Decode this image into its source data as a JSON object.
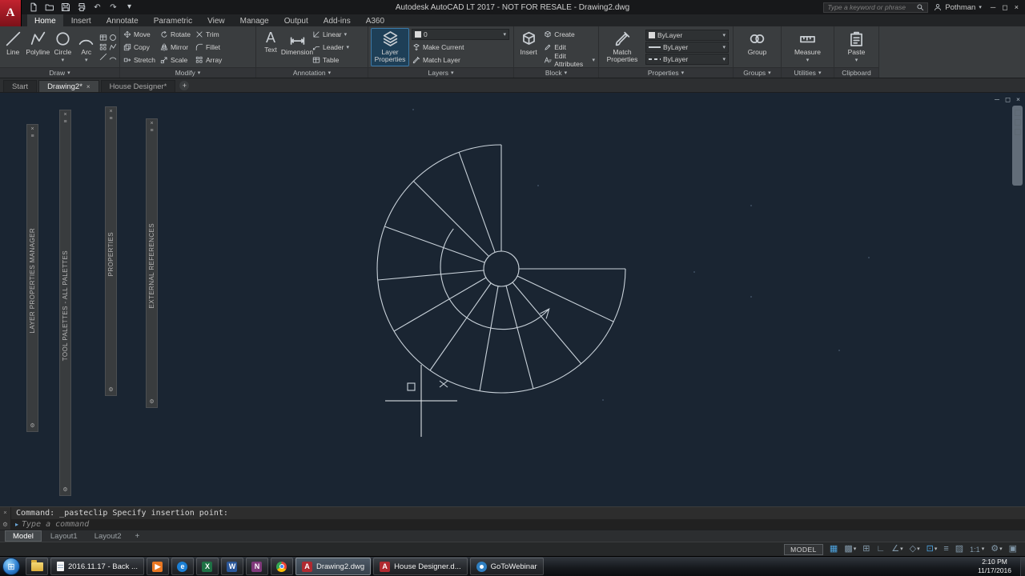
{
  "icons": {
    "caret": "▾",
    "close": "×",
    "minimize": "─",
    "maximize": "◻",
    "undo": "↶",
    "redo": "↷",
    "plus": "+",
    "app_logo": "A",
    "text_tool": "A",
    "menu": "≡",
    "gear": "⚙",
    "prompt_arrow": "▸",
    "grid": "▦",
    "snap": "▩",
    "infer": "⊞",
    "ortho": "∟",
    "polar": "∠",
    "iso": "◇",
    "osnap": "⊡",
    "lineweight": "≡",
    "transparency": "▨",
    "clean_screen": "▣",
    "start": "⊞",
    "play": "▶",
    "excel": "X",
    "word": "W",
    "onenote": "N",
    "ie": "e"
  },
  "titlebar": {
    "title": "Autodesk AutoCAD LT 2017 - NOT FOR RESALE - Drawing2.dwg",
    "search_placeholder": "Type a keyword or phrase",
    "user": "Pothman"
  },
  "ribbon": {
    "tabs": [
      {
        "label": "Home",
        "active": true
      },
      {
        "label": "Insert",
        "active": false
      },
      {
        "label": "Annotate",
        "active": false
      },
      {
        "label": "Parametric",
        "active": false
      },
      {
        "label": "View",
        "active": false
      },
      {
        "label": "Manage",
        "active": false
      },
      {
        "label": "Output",
        "active": false
      },
      {
        "label": "Add-ins",
        "active": false
      },
      {
        "label": "A360",
        "active": false
      }
    ],
    "panels": {
      "draw": {
        "label": "Draw",
        "line": "Line",
        "polyline": "Polyline",
        "circle": "Circle",
        "arc": "Arc"
      },
      "modify": {
        "label": "Modify",
        "move": "Move",
        "rotate": "Rotate",
        "trim": "Trim",
        "copy": "Copy",
        "mirror": "Mirror",
        "fillet": "Fillet",
        "stretch": "Stretch",
        "scale": "Scale",
        "array": "Array"
      },
      "annotation": {
        "label": "Annotation",
        "text": "Text",
        "dimension": "Dimension",
        "linear": "Linear",
        "leader": "Leader",
        "table": "Table"
      },
      "layers": {
        "label": "Layers",
        "layer_properties": "Layer Properties",
        "current_layer": "0",
        "make_current": "Make Current",
        "match_layer": "Match Layer"
      },
      "block": {
        "label": "Block",
        "insert": "Insert",
        "create": "Create",
        "edit": "Edit",
        "edit_attributes": "Edit Attributes"
      },
      "properties": {
        "label": "Properties",
        "match_properties": "Match Properties",
        "color": "ByLayer",
        "lineweight": "ByLayer",
        "linetype": "ByLayer"
      },
      "groups": {
        "label": "Groups",
        "group": "Group"
      },
      "utilities": {
        "label": "Utilities",
        "measure": "Measure"
      },
      "clipboard": {
        "label": "Clipboard",
        "paste": "Paste"
      }
    }
  },
  "file_tabs": [
    {
      "label": "Start",
      "active": false
    },
    {
      "label": "Drawing2*",
      "active": true
    },
    {
      "label": "House Designer*",
      "active": false
    }
  ],
  "palettes": [
    {
      "title": "LAYER PROPERTIES MANAGER"
    },
    {
      "title": "TOOL PALETTES - ALL PALETTES"
    },
    {
      "title": "PROPERTIES"
    },
    {
      "title": "EXTERNAL REFERENCES"
    }
  ],
  "command_line": {
    "history": "Command: _pasteclip Specify insertion point:",
    "placeholder": "Type a command"
  },
  "layout_tabs": [
    {
      "label": "Model",
      "active": true
    },
    {
      "label": "Layout1",
      "active": false
    },
    {
      "label": "Layout2",
      "active": false
    }
  ],
  "status_bar": {
    "model": "MODEL",
    "scale": "1:1"
  },
  "taskbar": {
    "explorer_label": "2016.11.17 - Back ...",
    "apps": [
      {
        "label": "Drawing2.dwg",
        "active": true
      },
      {
        "label": "House Designer.d...",
        "active": false
      },
      {
        "label": "GoToWebinar",
        "active": false
      }
    ],
    "clock": {
      "time": "2:10 PM",
      "date": "11/17/2016"
    }
  },
  "colors": {
    "canvas_bg": "#1a2532",
    "line": "#c9d2da",
    "accent": "#0696d7",
    "autocad_red": "#b02a30"
  }
}
